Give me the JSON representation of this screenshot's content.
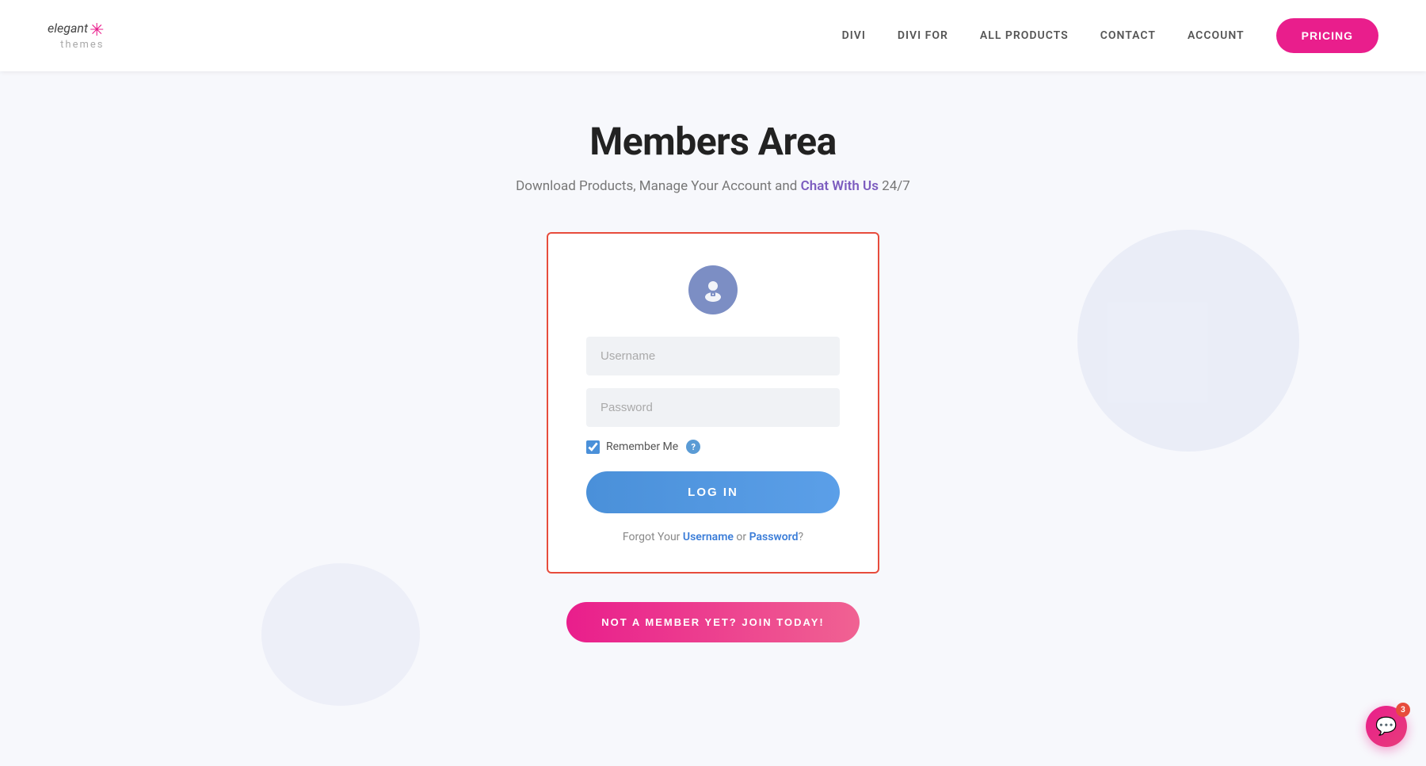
{
  "nav": {
    "logo_elegant": "elegant",
    "logo_star": "✳",
    "logo_themes": "themes",
    "links": [
      {
        "id": "divi",
        "label": "DIVI"
      },
      {
        "id": "divi-for",
        "label": "DIVI FOR"
      },
      {
        "id": "all-products",
        "label": "ALL PRODUCTS"
      },
      {
        "id": "contact",
        "label": "CONTACT"
      },
      {
        "id": "account",
        "label": "ACCOUNT"
      }
    ],
    "pricing_label": "PRICING"
  },
  "page": {
    "title": "Members Area",
    "subtitle_pre": "Download Products, Manage Your Account and ",
    "subtitle_link": "Chat With Us",
    "subtitle_post": " 24/7"
  },
  "form": {
    "username_placeholder": "Username",
    "password_placeholder": "Password",
    "remember_label": "Remember Me",
    "login_label": "LOG IN",
    "forgot_pre": "Forgot Your ",
    "forgot_username": "Username",
    "forgot_mid": " or ",
    "forgot_password": "Password",
    "forgot_post": "?"
  },
  "join": {
    "label": "NOT A MEMBER YET? JOIN TODAY!"
  },
  "chat": {
    "badge": "3"
  }
}
